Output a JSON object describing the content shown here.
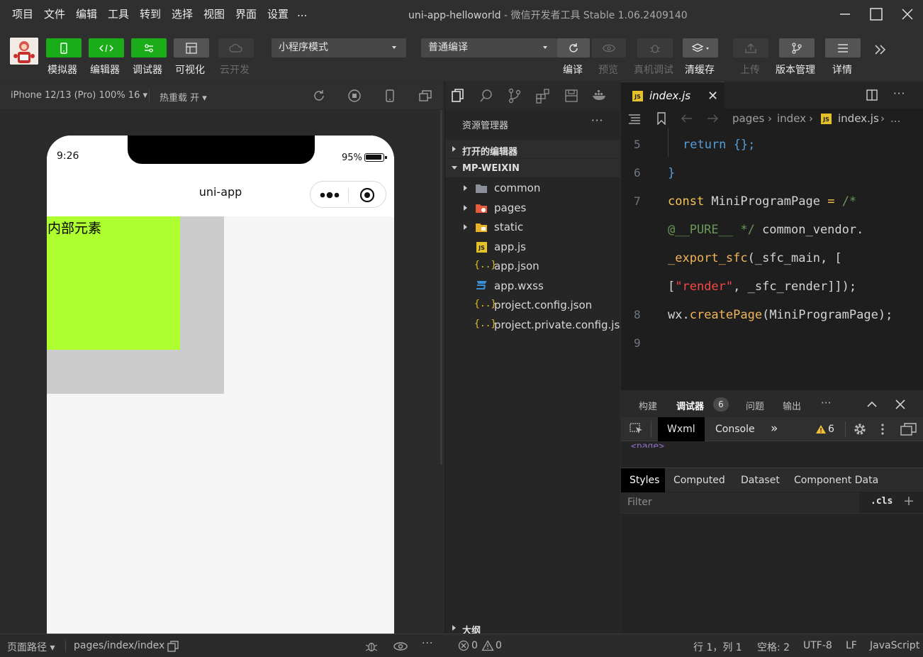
{
  "menu": [
    "项目",
    "文件",
    "编辑",
    "工具",
    "转到",
    "选择",
    "视图",
    "界面",
    "设置",
    "..."
  ],
  "window_title": "uni-app-helloworld",
  "window_subtitle": "- 微信开发者工具 Stable 1.06.2409140",
  "toolbar": {
    "simulator": "模拟器",
    "editor": "编辑器",
    "debugger": "调试器",
    "visual": "可视化",
    "cloud": "云开发",
    "mode_select": "小程序模式",
    "compile_select": "普通编译",
    "compile": "编译",
    "preview": "预览",
    "real_debug": "真机调试",
    "clear_cache": "清缓存",
    "upload": "上传",
    "version": "版本管理",
    "details": "详情"
  },
  "simulator": {
    "device": "iPhone 12/13 (Pro) 100% 16 ▾",
    "hot_reload": "热重载 开 ▾",
    "time": "9:26",
    "battery": "95%",
    "battery_level": 0.95,
    "nav_title": "uni-app",
    "inner_text": "内部元素"
  },
  "explorer": {
    "title": "资源管理器",
    "more": "···",
    "open_editors": "打开的编辑器",
    "project": "MP-WEIXIN",
    "files": [
      {
        "name": "common",
        "type": "folder"
      },
      {
        "name": "pages",
        "type": "folder"
      },
      {
        "name": "static",
        "type": "folder"
      },
      {
        "name": "app.js",
        "type": "js"
      },
      {
        "name": "app.json",
        "type": "json"
      },
      {
        "name": "app.wxss",
        "type": "css"
      },
      {
        "name": "project.config.json",
        "type": "json"
      },
      {
        "name": "project.private.config.js...",
        "type": "json"
      }
    ],
    "outline": "大纲"
  },
  "editor": {
    "tab": "index.js",
    "breadcrumb": [
      "pages",
      "index",
      "index.js",
      "..."
    ],
    "line_numbers": [
      "5",
      "6",
      "7",
      "",
      "",
      "",
      "8",
      "9"
    ]
  },
  "debugger": {
    "tabs": [
      "构建",
      "调试器",
      "问题",
      "输出",
      "···"
    ],
    "badge": "6",
    "dev_tabs": [
      "Wxml",
      "Console",
      "»"
    ],
    "warn_count": "6",
    "page_tag": "<page>",
    "style_tabs": [
      "Styles",
      "Computed",
      "Dataset",
      "Component Data"
    ],
    "filter_placeholder": "Filter",
    "cls": ".cls",
    "plus": "+"
  },
  "statusbar": {
    "page_path_label": "页面路径 ▾",
    "page_path": "pages/index/index",
    "errors": "0",
    "warnings": "0",
    "position": "行 1，列 1",
    "spaces": "空格: 2",
    "encoding": "UTF-8",
    "eol": "LF",
    "language": "JavaScript"
  },
  "colors": {
    "green": "#1aad19",
    "inner_box": "#adff2f",
    "outer_box": "#cccccc"
  }
}
